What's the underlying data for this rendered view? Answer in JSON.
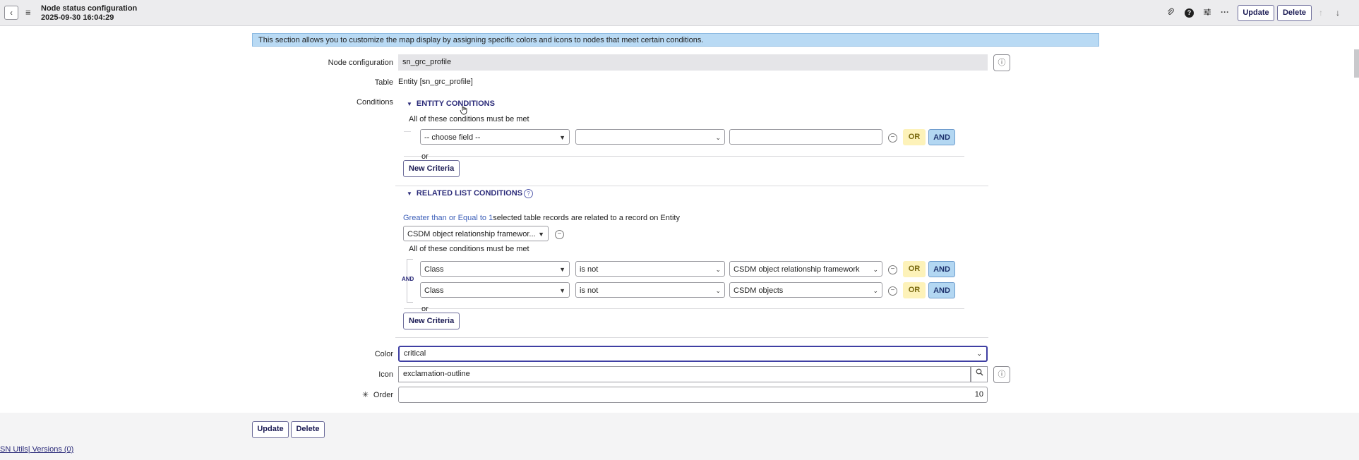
{
  "header": {
    "back_icon": "chevron-left-icon",
    "menu_icon": "hamburger-icon",
    "title": "Node status configuration",
    "timestamp": "2025-09-30 16:04:29",
    "attach_icon": "paperclip-icon",
    "help_glyph": "?",
    "settings_icon": "sliders-icon",
    "more_glyph": "···",
    "update_label": "Update",
    "delete_label": "Delete",
    "up_glyph": "↑",
    "down_glyph": "↓"
  },
  "banner": "This section allows you to customize the map display by assigning specific colors and icons to nodes that meet certain conditions.",
  "node_configuration": {
    "label": "Node configuration",
    "value": "sn_grc_profile"
  },
  "table": {
    "label": "Table",
    "value": "Entity [sn_grc_profile]"
  },
  "conditions": {
    "label": "Conditions",
    "entity": {
      "title": "ENTITY CONDITIONS",
      "note": "All of these conditions must be met",
      "field_placeholder": "-- choose field --",
      "operator": "",
      "value": "",
      "or_label": "OR",
      "and_label": "AND",
      "or_separator": "or",
      "new_criteria": "New Criteria"
    },
    "related": {
      "title": "RELATED LIST CONDITIONS",
      "quantifier_link": "Greater than or Equal to 1",
      "sentence": "selected table records are related to a record on Entity",
      "related_table": "CSDM object relationship framewor...",
      "note": "All of these conditions must be met",
      "and_group_label": "AND",
      "rows": [
        {
          "field": "Class",
          "operator": "is not",
          "value": "CSDM object relationship framework"
        },
        {
          "field": "Class",
          "operator": "is not",
          "value": "CSDM objects"
        }
      ],
      "or_label": "OR",
      "and_label": "AND",
      "or_separator": "or",
      "new_criteria": "New Criteria"
    }
  },
  "color": {
    "label": "Color",
    "value": "critical"
  },
  "icon": {
    "label": "Icon",
    "value": "exclamation-outline"
  },
  "order": {
    "label": "Order",
    "value": "10",
    "required_mark": "✳"
  },
  "form_buttons": {
    "update_label": "Update",
    "delete_label": "Delete"
  },
  "footer": {
    "links": "SN Utils| Versions (0)"
  }
}
